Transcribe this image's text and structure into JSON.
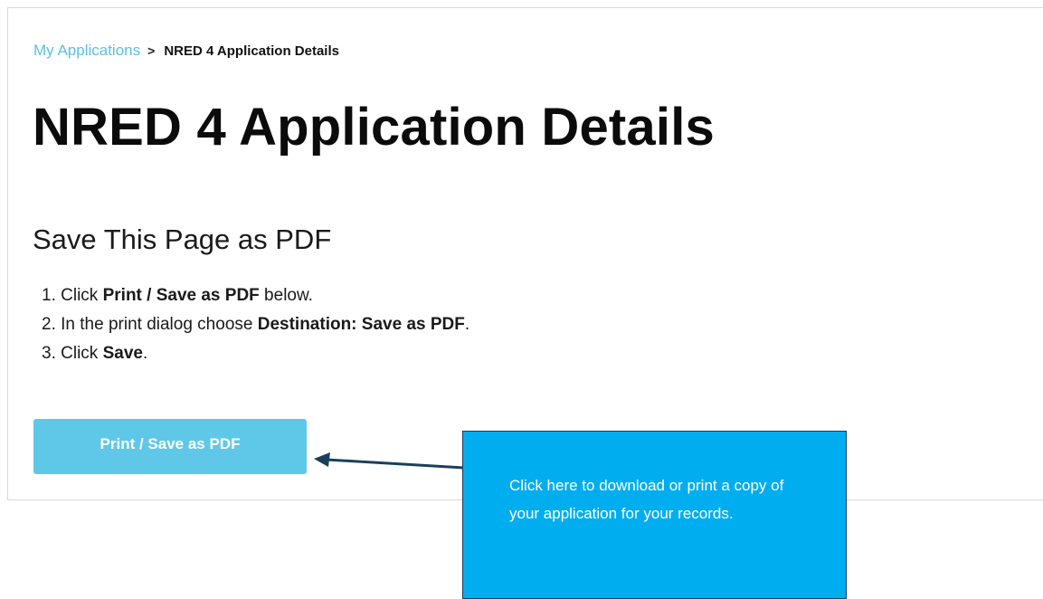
{
  "breadcrumb": {
    "parent_label": "My Applications",
    "separator": ">",
    "current_label": "NRED 4 Application Details"
  },
  "page_title": "NRED 4 Application Details",
  "save_section": {
    "heading": "Save This Page as PDF",
    "steps": [
      {
        "number": "1.",
        "before": "Click ",
        "bold": "Print / Save as PDF",
        "after": " below."
      },
      {
        "number": "2.",
        "before": "In the print dialog choose ",
        "bold": "Destination: Save as PDF",
        "after": "."
      },
      {
        "number": "3.",
        "before": "Click ",
        "bold": "Save",
        "after": "."
      }
    ],
    "button_label": "Print / Save as PDF"
  },
  "callout": {
    "text": "Click here to download or print a copy of your application for your records."
  },
  "colors": {
    "link": "#5bbfe3",
    "button": "#5fc8e8",
    "callout_bg": "#00aeef",
    "arrow": "#1a3f5c"
  }
}
